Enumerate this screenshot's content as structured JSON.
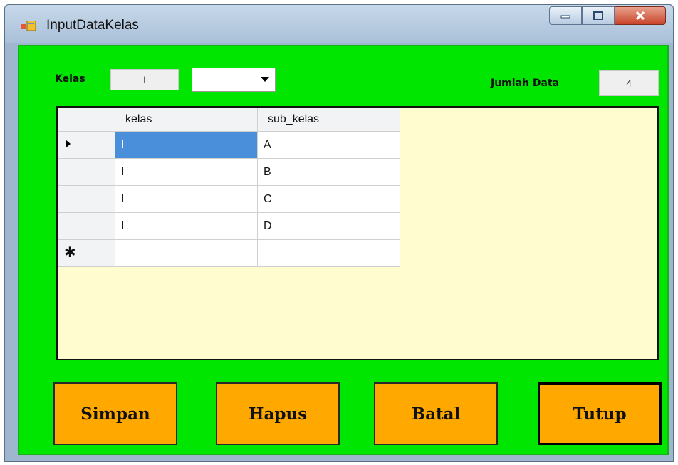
{
  "window": {
    "title": "InputDataKelas"
  },
  "form": {
    "kelas_label": "Kelas",
    "kelas_value": "I",
    "sub_kelas_value": "",
    "jumlah_label": "Jumlah Data",
    "jumlah_value": "4"
  },
  "grid": {
    "columns": [
      "kelas",
      "sub_kelas"
    ],
    "rows": [
      {
        "kelas": "I",
        "sub_kelas": "A"
      },
      {
        "kelas": "I",
        "sub_kelas": "B"
      },
      {
        "kelas": "I",
        "sub_kelas": "C"
      },
      {
        "kelas": "I",
        "sub_kelas": "D"
      }
    ],
    "new_row_marker": "✱"
  },
  "buttons": {
    "simpan": "Simpan",
    "hapus": "Hapus",
    "batal": "Batal",
    "tutup": "Tutup"
  },
  "colors": {
    "form_bg": "#00e600",
    "grid_bg": "#fffdd0",
    "button_bg": "#ffa800",
    "selection": "#4a8fd9"
  }
}
